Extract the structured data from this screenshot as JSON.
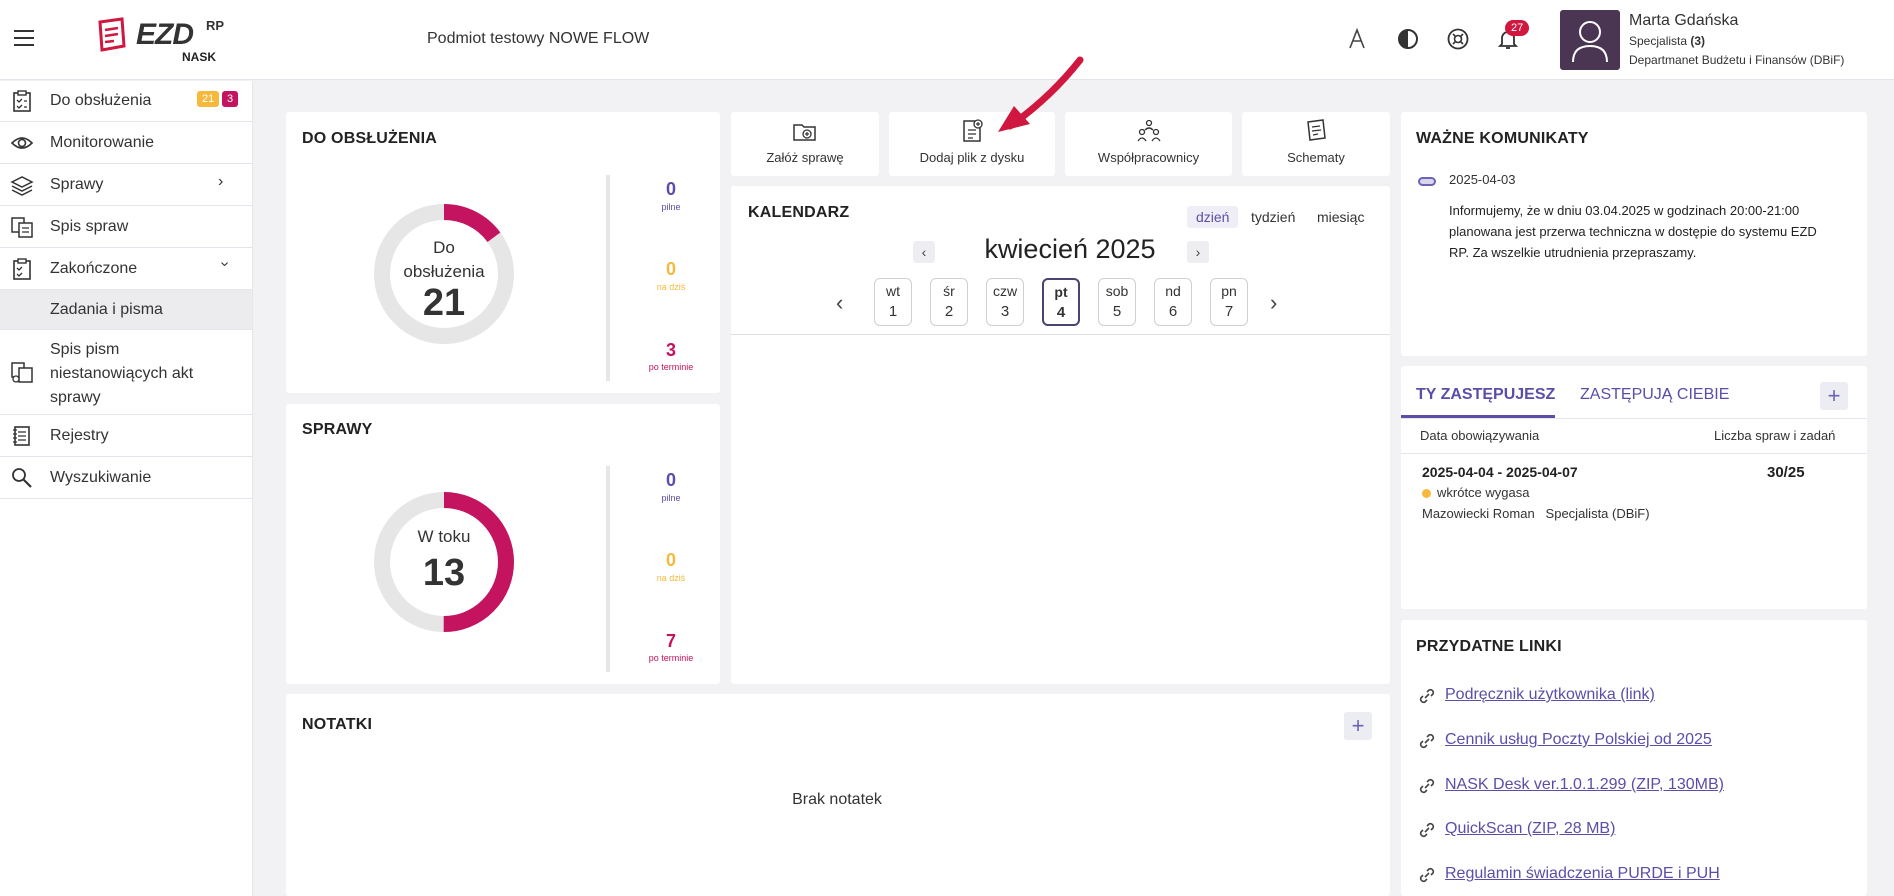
{
  "header": {
    "logo_text": "EZD",
    "logo_rp": "RP",
    "logo_nask": "NASK",
    "entity": "Podmiot testowy NOWE FLOW",
    "notifications_count": "27",
    "user": {
      "name": "Marta Gdańska",
      "role_prefix": "Specjalista ",
      "role_count": "(3)",
      "department": "Departmanet Budżetu i Finansów (DBiF)"
    }
  },
  "sidebar": {
    "items": [
      {
        "label": "Do obsłużenia",
        "badge_a": "21",
        "badge_b": "3"
      },
      {
        "label": "Monitorowanie"
      },
      {
        "label": "Sprawy"
      },
      {
        "label": "Spis spraw"
      },
      {
        "label": "Zakończone"
      },
      {
        "label": "Zadania i pisma"
      },
      {
        "label": "Spis pism niestanowiących akt sprawy"
      },
      {
        "label": "Rejestry"
      },
      {
        "label": "Wyszukiwanie"
      }
    ]
  },
  "do_obsluzenia": {
    "title": "DO OBSŁUŻENIA",
    "donut_label_1": "Do",
    "donut_label_2": "obsłużenia",
    "total": "21",
    "urgent": "0",
    "urgent_label": "pilne",
    "today": "0",
    "today_label": "na dziś",
    "overdue": "3",
    "overdue_label": "po terminie"
  },
  "sprawy": {
    "title": "SPRAWY",
    "donut_label": "W toku",
    "total": "13",
    "urgent": "0",
    "urgent_label": "pilne",
    "today": "0",
    "today_label": "na dziś",
    "overdue": "7",
    "overdue_label": "po terminie"
  },
  "quick_actions": [
    {
      "label": "Załóż sprawę",
      "icon": "folder-add-icon"
    },
    {
      "label": "Dodaj plik z dysku",
      "icon": "file-add-icon"
    },
    {
      "label": "Współpracownicy",
      "icon": "people-icon"
    },
    {
      "label": "Schematy",
      "icon": "schema-icon"
    }
  ],
  "calendar": {
    "title": "KALENDARZ",
    "views": [
      "dzień",
      "tydzień",
      "miesiąc"
    ],
    "month": "kwiecień 2025",
    "days": [
      {
        "name": "wt",
        "num": "1"
      },
      {
        "name": "śr",
        "num": "2"
      },
      {
        "name": "czw",
        "num": "3"
      },
      {
        "name": "pt",
        "num": "4"
      },
      {
        "name": "sob",
        "num": "5"
      },
      {
        "name": "nd",
        "num": "6"
      },
      {
        "name": "pn",
        "num": "7"
      }
    ]
  },
  "komunikaty": {
    "title": "WAŻNE KOMUNIKATY",
    "date": "2025-04-03",
    "text": "Informujemy, że w dniu 03.04.2025 w godzinach 20:00-21:00 planowana jest przerwa techniczna w dostępie do systemu EZD RP. Za wszelkie utrudnienia przepraszamy."
  },
  "zastepstwa": {
    "tab_active": "TY ZASTĘPUJESZ",
    "tab_other": "ZASTĘPUJĄ CIEBIE",
    "col_date": "Data obowiązywania",
    "col_count": "Liczba spraw i zadań",
    "row": {
      "dates": "2025-04-04 - 2025-04-07",
      "count": "30/25",
      "status": "wkrótce wygasa",
      "person": "Mazowiecki Roman",
      "role": "Specjalista (DBiF)"
    }
  },
  "links": {
    "title": "PRZYDATNE LINKI",
    "items": [
      "Podręcznik użytkownika (link)",
      "Cennik usług Poczty Polskiej od 2025",
      "NASK Desk ver.1.0.1.299 (ZIP, 130MB)",
      "QuickScan (ZIP, 28 MB)",
      "Regulamin świadczenia PURDE i PUH"
    ]
  },
  "notatki": {
    "title": "NOTATKI",
    "empty": "Brak notatek"
  },
  "colors": {
    "accent": "#5b4ea8",
    "magenta": "#c4135f",
    "orange": "#f6b93b",
    "arrow": "#d0173f"
  }
}
